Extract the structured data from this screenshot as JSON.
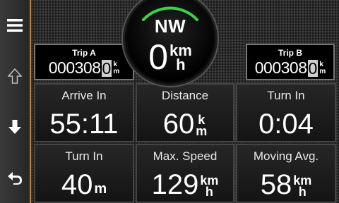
{
  "sidebar": {
    "menu_icon": "hamburger-menu-icon",
    "up_icon": "arrow-up-outline-icon",
    "down_icon": "arrow-down-icon",
    "back_icon": "back-arrow-icon",
    "accent_color": "#e07a10"
  },
  "dial": {
    "heading": "NW",
    "speed": "0",
    "speed_unit_top": "km",
    "speed_unit_bottom": "h",
    "arc_color": "#3ecf4a"
  },
  "trip_a": {
    "title": "Trip A",
    "digits": "000308",
    "last_digit": "0",
    "unit_top": "k",
    "unit_bottom": "m"
  },
  "trip_b": {
    "title": "Trip B",
    "digits": "000308",
    "last_digit": "0",
    "unit_top": "k",
    "unit_bottom": "m"
  },
  "fields": [
    {
      "label": "Arrive In",
      "value": "55:11"
    },
    {
      "label": "Distance",
      "value": "60",
      "unit_top": "k",
      "unit_bottom": "m"
    },
    {
      "label": "Turn In",
      "value": "0:04"
    },
    {
      "label": "Turn In",
      "value": "40",
      "unit": "m"
    },
    {
      "label": "Max. Speed",
      "value": "129",
      "unit_top": "km",
      "unit_bottom": "h"
    },
    {
      "label": "Moving Avg.",
      "value": "58",
      "unit_top": "km",
      "unit_bottom": "h"
    }
  ]
}
